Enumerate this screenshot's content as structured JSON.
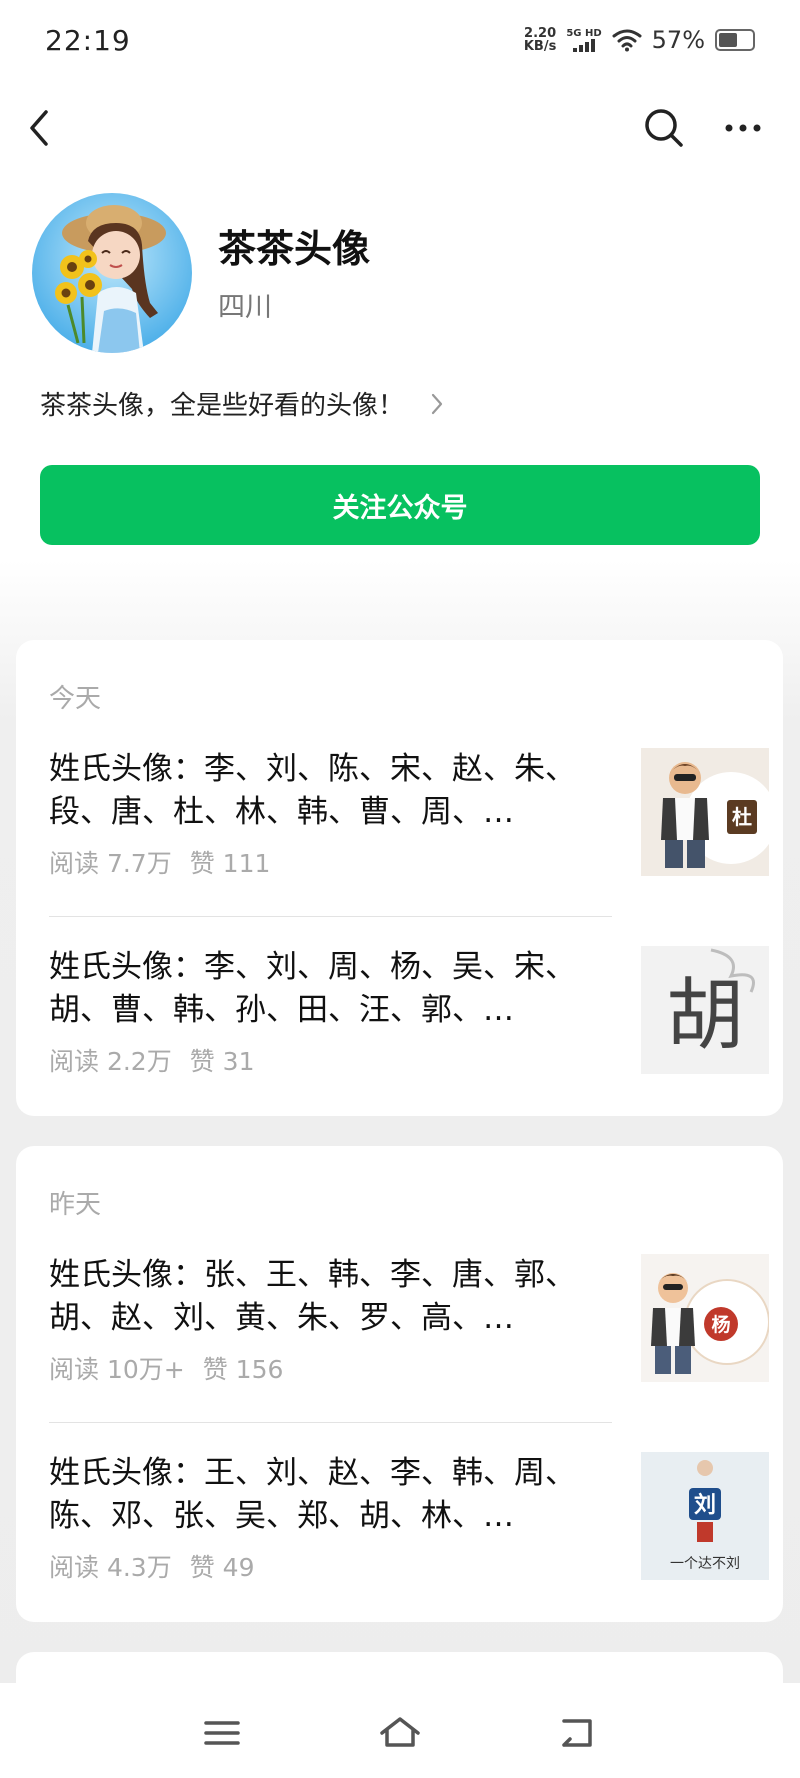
{
  "status_bar": {
    "time": "22:19",
    "net_speed_value": "2.20",
    "net_speed_unit": "KB/s",
    "signal_label": "5G HD",
    "battery_percent": "57%",
    "battery_level": 0.57
  },
  "nav": {
    "back_icon": "chevron-left-icon",
    "search_icon": "search-icon",
    "more_icon": "more-dots-icon"
  },
  "profile": {
    "name": "茶茶头像",
    "region": "四川",
    "intro": "茶茶头像，全是些好看的头像！",
    "follow_label": "关注公众号"
  },
  "groups": [
    {
      "day": "今天",
      "articles": [
        {
          "title": "姓氏头像：李、刘、陈、宋、赵、朱、段、唐、杜、林、韩、曹、周、…",
          "reads": "阅读 7.7万",
          "likes": "赞 111",
          "thumb_text": "杜"
        },
        {
          "title": "姓氏头像：李、刘、周、杨、吴、宋、胡、曹、韩、孙、田、汪、郭、…",
          "reads": "阅读 2.2万",
          "likes": "赞 31",
          "thumb_text": "胡"
        }
      ]
    },
    {
      "day": "昨天",
      "articles": [
        {
          "title": "姓氏头像：张、王、韩、李、唐、郭、胡、赵、刘、黄、朱、罗、高、…",
          "reads": "阅读 10万+",
          "likes": "赞 156",
          "thumb_text": "杨"
        },
        {
          "title": "姓氏头像：王、刘、赵、李、韩、周、陈、邓、张、吴、郑、胡、林、…",
          "reads": "阅读 4.3万",
          "likes": "赞 49",
          "thumb_text": "刘",
          "thumb_caption": "一个达不刘"
        }
      ]
    }
  ],
  "system_nav": {
    "menu_icon": "menu-icon",
    "home_icon": "home-icon",
    "back_icon": "back-icon"
  },
  "colors": {
    "accent": "#07c160",
    "meta_text": "#aaaaaa",
    "background": "#ededed"
  }
}
